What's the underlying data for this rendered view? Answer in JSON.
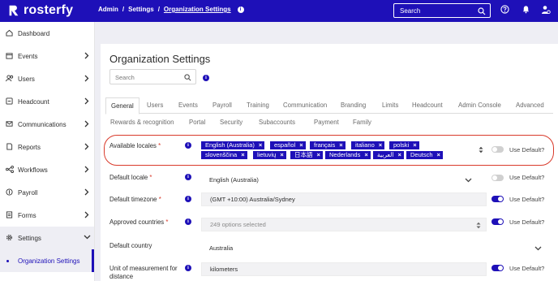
{
  "brand": {
    "name": "rosterfy",
    "color": "#1e10b8"
  },
  "header": {
    "crumbs": [
      "Admin",
      "Settings",
      "Organization Settings"
    ],
    "search_placeholder": "Search",
    "icons": [
      "search-icon",
      "help-icon",
      "bell-icon",
      "user-settings-icon"
    ]
  },
  "sidebar": {
    "items": [
      {
        "label": "Dashboard",
        "icon": "home-icon"
      },
      {
        "label": "Events",
        "icon": "calendar-icon"
      },
      {
        "label": "Users",
        "icon": "users-icon"
      },
      {
        "label": "Headcount",
        "icon": "headcount-icon"
      },
      {
        "label": "Communications",
        "icon": "mail-icon"
      },
      {
        "label": "Reports",
        "icon": "report-icon"
      },
      {
        "label": "Workflows",
        "icon": "workflow-icon"
      },
      {
        "label": "Payroll",
        "icon": "payroll-icon"
      },
      {
        "label": "Forms",
        "icon": "forms-icon"
      },
      {
        "label": "Settings",
        "icon": "gear-icon"
      }
    ],
    "sub_item": "Organization Settings"
  },
  "page": {
    "title": "Organization Settings",
    "search_placeholder": "Search"
  },
  "tabs_row1": [
    "General",
    "Users",
    "Events",
    "Payroll",
    "Training",
    "Communication",
    "Branding",
    "Limits",
    "Headcount",
    "Admin Console",
    "Advanced"
  ],
  "tabs_row2": [
    "Rewards & recognition",
    "Portal",
    "Security",
    "Subaccounts",
    "Payment",
    "Family"
  ],
  "active_tab": "General",
  "use_default_label": "Use Default?",
  "rows": {
    "available_locales": {
      "label": "Available locales",
      "tags": [
        "English (Australia)",
        "español",
        "français",
        "italiano",
        "polski",
        "slovenščina",
        "lietuvių",
        "日本語",
        "Nederlands",
        "العربية",
        "Deutsch"
      ],
      "use_default": false
    },
    "default_locale": {
      "label": "Default locale",
      "value": "English (Australia)",
      "use_default": false
    },
    "default_timezone": {
      "label": "Default timezone",
      "value": "(GMT +10:00) Australia/Sydney",
      "use_default": true
    },
    "approved_countries": {
      "label": "Approved countries",
      "placeholder": "249 options selected",
      "use_default": true
    },
    "default_country": {
      "label": "Default country",
      "value": "Australia"
    },
    "unit_of_measurement": {
      "label_line1": "Unit of measurement for",
      "label_line2": "distance",
      "value": "kilometers",
      "use_default": true
    }
  },
  "required_mark": "*",
  "tag_remove": "×",
  "info_glyph": "i"
}
